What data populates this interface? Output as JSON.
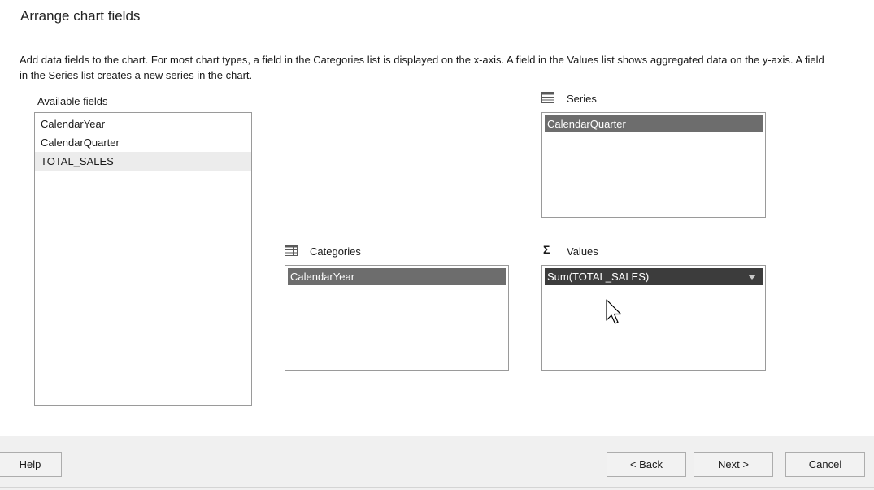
{
  "dialog": {
    "title": "Arrange chart fields",
    "description": "Add data fields to the chart. For most chart types, a field in the Categories list is displayed on the x-axis. A field in the Values list shows aggregated data on the y-axis. A field in the Series list creates a new series in the chart."
  },
  "available_fields": {
    "label": "Available fields",
    "items": [
      "CalendarYear",
      "CalendarQuarter",
      "TOTAL_SALES"
    ],
    "hovered_index": 2
  },
  "series": {
    "label": "Series",
    "icon": "table-grid-icon",
    "items": [
      "CalendarQuarter"
    ]
  },
  "categories": {
    "label": "Categories",
    "icon": "table-grid-icon",
    "items": [
      "CalendarYear"
    ]
  },
  "values": {
    "label": "Values",
    "icon": "sigma-icon",
    "icon_glyph": "Σ",
    "items": [
      "Sum(TOTAL_SALES)"
    ]
  },
  "buttons": {
    "help": "Help",
    "back": "< Back",
    "next": "Next >",
    "cancel": "Cancel"
  },
  "colors": {
    "selected_item": "#6d6d6d",
    "selected_item_dark": "#3c3c3c",
    "footer_bg": "#f0f0f0",
    "hover_item": "#ececec"
  }
}
